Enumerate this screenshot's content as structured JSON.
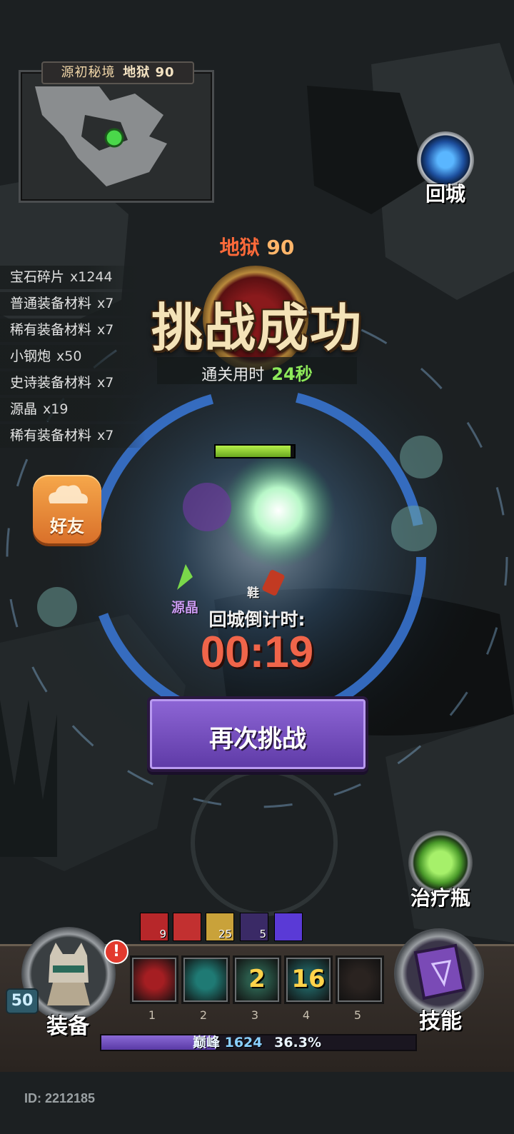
{
  "minimap": {
    "title": "源初秘境",
    "floor": "地狱 90"
  },
  "loot": [
    {
      "name": "宝石碎片",
      "qty": "x1244"
    },
    {
      "name": "普通装备材料",
      "qty": "x7"
    },
    {
      "name": "稀有装备材料",
      "qty": "x7"
    },
    {
      "name": "小钢炮",
      "qty": "x50"
    },
    {
      "name": "史诗装备材料",
      "qty": "x7"
    },
    {
      "name": "源晶",
      "qty": "x19"
    },
    {
      "name": "稀有装备材料",
      "qty": "x7"
    }
  ],
  "result": {
    "stage_name": "地狱",
    "stage_level": "90",
    "title": "挑战成功",
    "clear_label": "通关用时",
    "clear_time": "24秒"
  },
  "buttons": {
    "return_town": "回城",
    "friend": "好友",
    "retry": "再次挑战",
    "heal_potion": "治疗瓶",
    "equipment": "装备",
    "skills": "技能"
  },
  "countdown": {
    "label": "回城倒计时:",
    "value": "00:19"
  },
  "drops": {
    "crystal": "源晶",
    "shoe": "鞋"
  },
  "buffs": [
    {
      "count": "9",
      "color": "#b7272a"
    },
    {
      "count": "",
      "color": "#c23030"
    },
    {
      "count": "25",
      "color": "#c9a23a"
    },
    {
      "count": "5",
      "color": "#3a2a66"
    },
    {
      "count": "",
      "color": "#5a3ad6"
    }
  ],
  "skill_slots": [
    {
      "num": "1",
      "cooldown": "",
      "color": "#a51e22"
    },
    {
      "num": "2",
      "cooldown": "",
      "color": "#1f7a74"
    },
    {
      "num": "3",
      "cooldown": "2",
      "color": "#2a5a4a"
    },
    {
      "num": "4",
      "cooldown": "16",
      "color": "#1f5a5a"
    },
    {
      "num": "5",
      "cooldown": "",
      "color": "#2a2320"
    }
  ],
  "player": {
    "level": "50",
    "rank_label": "巅峰",
    "rank_value": "1624",
    "xp_percent": "36.3%",
    "xp_fraction": 0.363,
    "id_text": "ID: 2212185"
  },
  "enemy": {
    "hp_fraction": 0.95
  },
  "colors": {
    "accent_orange": "#ff6a3a",
    "countdown_red": "#f0654a",
    "retry_purple": "#6e48ba",
    "clear_green": "#8eea5a"
  }
}
